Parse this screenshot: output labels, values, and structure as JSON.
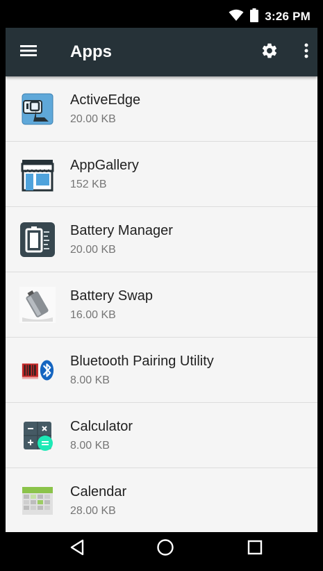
{
  "status_bar": {
    "time": "3:26 PM",
    "icons": [
      "wifi-icon",
      "battery-icon"
    ]
  },
  "app_bar": {
    "title": "Apps",
    "icons": [
      "menu-icon",
      "settings-gear-icon",
      "overflow-menu-icon"
    ]
  },
  "apps": [
    {
      "name": "ActiveEdge",
      "size": "20.00 KB",
      "icon": "activeedge-app-icon"
    },
    {
      "name": "AppGallery",
      "size": "152 KB",
      "icon": "appgallery-app-icon"
    },
    {
      "name": "Battery Manager",
      "size": "20.00 KB",
      "icon": "battery-manager-app-icon"
    },
    {
      "name": "Battery Swap",
      "size": "16.00 KB",
      "icon": "battery-swap-app-icon"
    },
    {
      "name": "Bluetooth Pairing Utility",
      "size": "8.00 KB",
      "icon": "bluetooth-pairing-app-icon"
    },
    {
      "name": "Calculator",
      "size": "8.00 KB",
      "icon": "calculator-app-icon"
    },
    {
      "name": "Calendar",
      "size": "28.00 KB",
      "icon": "calendar-app-icon"
    }
  ],
  "nav_bar": {
    "buttons": [
      "back-icon",
      "home-icon",
      "recents-icon"
    ]
  },
  "colors": {
    "app_bar": "#263238",
    "background": "#f5f5f5",
    "primary_text": "#212121",
    "secondary_text": "#757575",
    "divider": "#dcdcdc"
  }
}
